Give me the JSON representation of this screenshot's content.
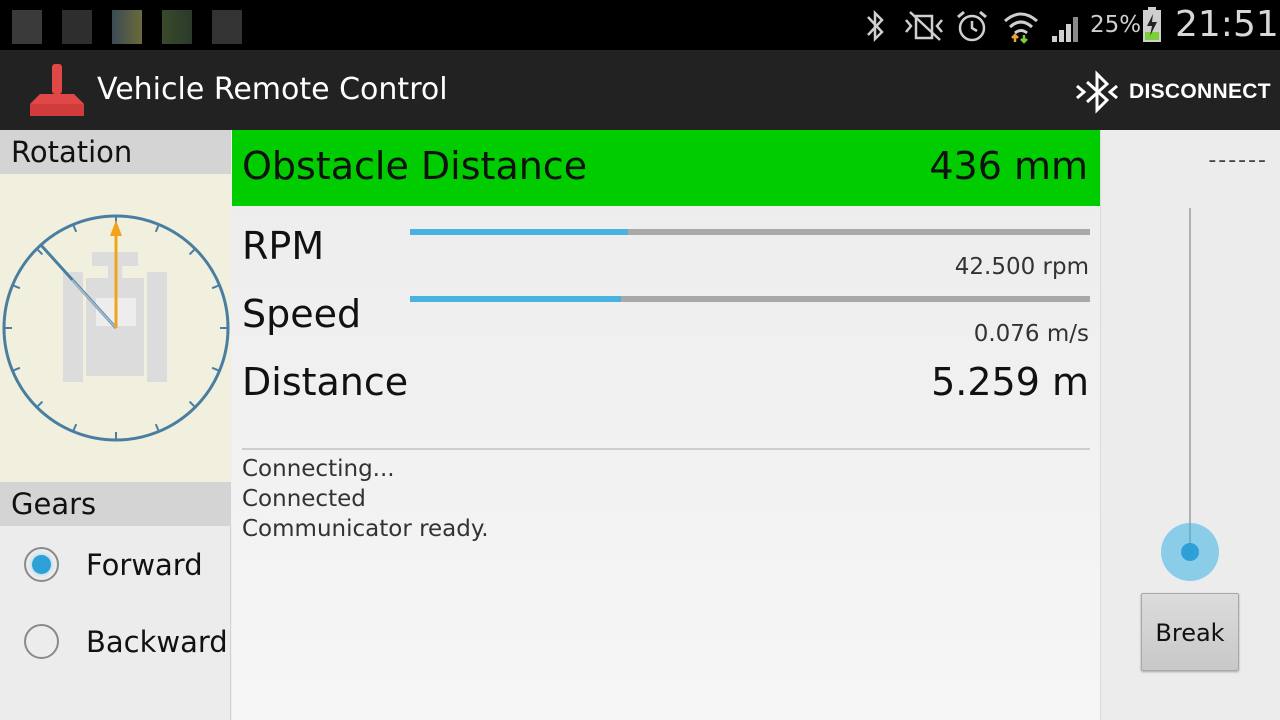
{
  "status_bar": {
    "battery_percent": "25%",
    "time": "21:51",
    "icons": [
      "bluetooth-icon",
      "vibrate-icon",
      "alarm-icon",
      "wifi-icon",
      "signal-icon",
      "battery-charging-icon"
    ]
  },
  "action_bar": {
    "title": "Vehicle Remote Control",
    "disconnect_label": "DISCONNECT"
  },
  "left_panel": {
    "rotation_header": "Rotation",
    "gears_header": "Gears",
    "gears": [
      {
        "label": "Forward",
        "checked": true
      },
      {
        "label": "Backward",
        "checked": false
      }
    ]
  },
  "center_panel": {
    "obstacle": {
      "label": "Obstacle Distance",
      "value": "436 mm",
      "color": "#00cc00"
    },
    "rpm": {
      "label": "RPM",
      "value": "42.500 rpm",
      "level": 0.32
    },
    "speed": {
      "label": "Speed",
      "value": "0.076 m/s",
      "level": 0.31
    },
    "distance": {
      "label": "Distance",
      "value": "5.259 m"
    },
    "log": [
      "Connecting...",
      "Connected",
      "Communicator ready."
    ]
  },
  "right_panel": {
    "indicator": "------",
    "break_label": "Break"
  },
  "colors": {
    "accent": "#2ea0d8",
    "obstacle_ok": "#00cc00",
    "action_bar": "#222222"
  }
}
